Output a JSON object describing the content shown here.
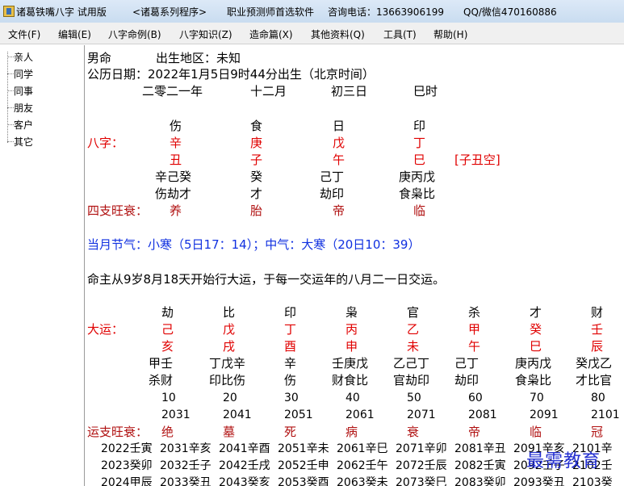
{
  "titlebar": {
    "app_name": "诸葛铁嘴八字 试用版",
    "series": "<诸葛系列程序>",
    "slogan": "职业预测师首选软件",
    "phone": "咨询电话：13663906199",
    "qq": "QQ/微信470160886"
  },
  "menu": [
    {
      "label": "文件(F)"
    },
    {
      "label": "编辑(E)"
    },
    {
      "label": "八字命例(B)"
    },
    {
      "label": "八字知识(Z)"
    },
    {
      "label": "造命篇(X)"
    },
    {
      "label": "其他资料(Q)"
    },
    {
      "label": "工具(T)"
    },
    {
      "label": "帮助(H)"
    }
  ],
  "tree": [
    "亲人",
    "同学",
    "同事",
    "朋友",
    "客户",
    "其它"
  ],
  "info": {
    "gender": "男命",
    "place": "出生地区：未知",
    "date": "公历日期：2022年1月5日9时44分出生（北京时间）",
    "lunar": [
      "二零二一年",
      "十二月",
      "初三日",
      "巳时"
    ]
  },
  "bazi": {
    "label": "八字：",
    "gods": [
      "伤",
      "食",
      "日",
      "印"
    ],
    "stems": [
      "辛",
      "庚",
      "戊",
      "丁"
    ],
    "branches": [
      "丑",
      "子",
      "午",
      "巳"
    ],
    "kong": "[子丑空]",
    "hidden": [
      "辛己癸",
      "癸",
      "己丁",
      "庚丙戊"
    ],
    "hidden_gods": [
      "伤劫才",
      "才",
      "劫印",
      "食枭比"
    ],
    "state_label": "四支旺衰：",
    "states": [
      "养",
      "胎",
      "帝",
      "临"
    ]
  },
  "jieqi": "当月节气：小寒（5日17：14）；中气：大寒（20日10：39）",
  "dayun_note": "命主从9岁8月18天开始行大运，于每一交运年的八月二一日交运。",
  "dayun": {
    "label": "大运：",
    "gods": [
      "劫",
      "比",
      "印",
      "枭",
      "官",
      "杀",
      "才",
      "财"
    ],
    "stems": [
      "己",
      "戊",
      "丁",
      "丙",
      "乙",
      "甲",
      "癸",
      "壬"
    ],
    "branches": [
      "亥",
      "戌",
      "酉",
      "申",
      "未",
      "午",
      "巳",
      "辰"
    ],
    "hidden": [
      "甲壬",
      "丁戊辛",
      "辛",
      "壬庚戊",
      "乙己丁",
      "己丁",
      "庚丙戊",
      "癸戊乙"
    ],
    "hidden_gods": [
      "杀财",
      "印比伤",
      "伤",
      "财食比",
      "官劫印",
      "劫印",
      "食枭比",
      "才比官"
    ],
    "ages": [
      "10",
      "20",
      "30",
      "40",
      "50",
      "60",
      "70",
      "80"
    ],
    "years": [
      "2031",
      "2041",
      "2051",
      "2061",
      "2071",
      "2081",
      "2091",
      "2101"
    ],
    "state_label": "运支旺衰：",
    "states": [
      "绝",
      "墓",
      "死",
      "病",
      "衰",
      "帝",
      "临",
      "冠"
    ]
  },
  "liunian": [
    [
      "2022壬寅",
      "2031辛亥",
      "2041辛酉",
      "2051辛未",
      "2061辛巳",
      "2071辛卯",
      "2081辛丑",
      "2091辛亥",
      "2101辛"
    ],
    [
      "2023癸卯",
      "2032壬子",
      "2042壬戌",
      "2052壬申",
      "2062壬午",
      "2072壬辰",
      "2082壬寅",
      "2092壬子",
      "2102壬"
    ],
    [
      "2024甲辰",
      "2033癸丑",
      "2043癸亥",
      "2053癸酉",
      "2063癸未",
      "2073癸巳",
      "2083癸卯",
      "2093癸丑",
      "2103癸"
    ]
  ],
  "watermark": "最需教育",
  "colors": {
    "stem_branch": "#e00000",
    "state": "#b01010",
    "jieqi": "#1030e0"
  }
}
